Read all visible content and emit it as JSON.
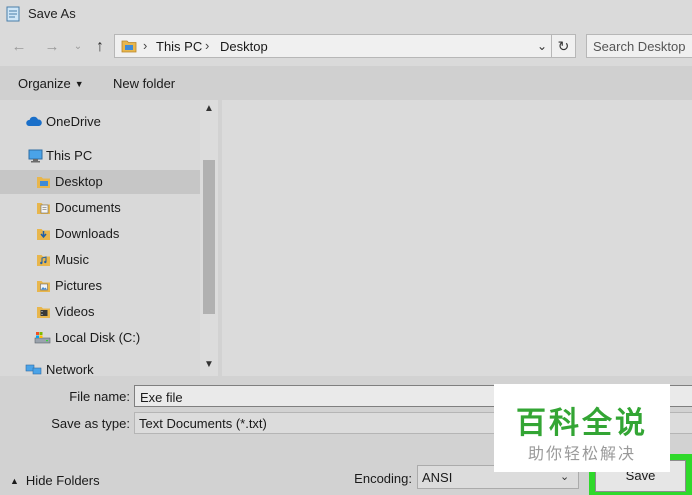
{
  "window": {
    "title": "Save As",
    "icons": {
      "app": "notepad-icon"
    }
  },
  "navigation": {
    "back_icon": "back-arrow-icon",
    "forward_icon": "forward-arrow-icon",
    "recent_icon": "chevron-down-icon",
    "up_icon": "up-arrow-icon"
  },
  "address_bar": {
    "breadcrumbs": [
      "This PC",
      "Desktop"
    ],
    "separator": "›",
    "folder_icon": "folder-icon",
    "refresh_icon": "refresh-icon"
  },
  "search": {
    "placeholder": "Search Desktop"
  },
  "toolbar": {
    "organize_label": "Organize",
    "new_folder_label": "New folder"
  },
  "nav_pane": {
    "items": [
      {
        "label": "OneDrive",
        "icon": "cloud-icon",
        "selected": false
      },
      {
        "label": "This PC",
        "icon": "computer-icon",
        "selected": false
      },
      {
        "label": "Desktop",
        "icon": "desktop-folder-icon",
        "selected": true
      },
      {
        "label": "Documents",
        "icon": "documents-folder-icon",
        "selected": false
      },
      {
        "label": "Downloads",
        "icon": "downloads-folder-icon",
        "selected": false
      },
      {
        "label": "Music",
        "icon": "music-folder-icon",
        "selected": false
      },
      {
        "label": "Pictures",
        "icon": "pictures-folder-icon",
        "selected": false
      },
      {
        "label": "Videos",
        "icon": "videos-folder-icon",
        "selected": false
      },
      {
        "label": "Local Disk (C:)",
        "icon": "local-disk-icon",
        "selected": false
      },
      {
        "label": "Network",
        "icon": "network-icon",
        "selected": false
      }
    ]
  },
  "form": {
    "file_name_label": "File name:",
    "file_name_value": "Exe file",
    "save_as_type_label": "Save as type:",
    "save_as_type_value": "Text Documents (*.txt)",
    "encoding_label": "Encoding:",
    "encoding_value": "ANSI",
    "hide_folders_label": "Hide Folders",
    "save_label": "Save"
  },
  "watermark": {
    "main": "百科全说",
    "sub": "助你轻松解决"
  },
  "colors": {
    "highlight": "#2fd92b",
    "watermark_green": "#33a534",
    "selection": "#c6c6c6",
    "onedrive_blue": "#1a6fc9"
  }
}
